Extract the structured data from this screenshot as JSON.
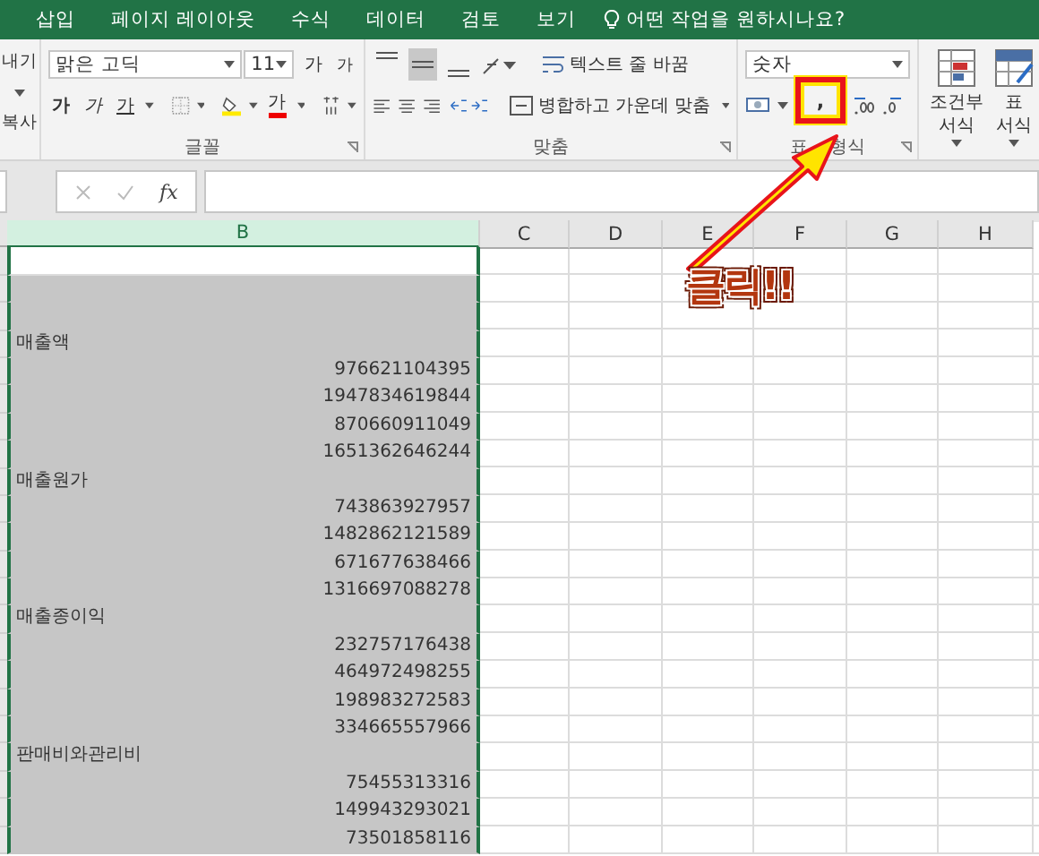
{
  "tabs": [
    {
      "label": "삽입"
    },
    {
      "label": "페이지 레이아웃"
    },
    {
      "label": "수식"
    },
    {
      "label": "데이터"
    },
    {
      "label": "검토"
    },
    {
      "label": "보기"
    }
  ],
  "tell_me": "어떤 작업을 원하시나요?",
  "ribbon": {
    "clipboard": {
      "items": [
        "내기",
        "복사"
      ]
    },
    "font": {
      "name": "맑은 고딕",
      "size": "11",
      "grow": "가",
      "shrink": "가",
      "bold": "가",
      "italic": "가",
      "underline": "가",
      "font_color": "가",
      "label": "글꼴"
    },
    "alignment": {
      "vertical": [
        {
          "selected": false
        },
        {
          "selected": true
        },
        {
          "selected": false
        }
      ],
      "wrap_text": "텍스트 줄 바꿈",
      "merge": "병합하고 가운데 맞춤",
      "label": "맞춤"
    },
    "number": {
      "format": "숫자",
      "comma": ",",
      "label_parts": [
        "표",
        "형식"
      ]
    },
    "styles": [
      {
        "label": "조건부 서식"
      },
      {
        "label": "표 서식"
      }
    ]
  },
  "formula_bar": {
    "fx": "fx"
  },
  "columns": [
    {
      "label": "B",
      "selected": true
    },
    {
      "label": "C",
      "selected": false
    },
    {
      "label": "D",
      "selected": false
    },
    {
      "label": "E",
      "selected": false
    },
    {
      "label": "F",
      "selected": false
    },
    {
      "label": "G",
      "selected": false
    },
    {
      "label": "H",
      "selected": false
    }
  ],
  "rows": [
    {
      "kind": "blank",
      "active": true
    },
    {
      "kind": "blank",
      "active": false
    },
    {
      "kind": "blank",
      "active": false
    },
    {
      "kind": "label",
      "text": "매출액",
      "active": false
    },
    {
      "kind": "number",
      "text": "976621104395",
      "active": false
    },
    {
      "kind": "number",
      "text": "1947834619844",
      "active": false
    },
    {
      "kind": "number",
      "text": "870660911049",
      "active": false
    },
    {
      "kind": "number",
      "text": "1651362646244",
      "active": false
    },
    {
      "kind": "label",
      "text": "매출원가",
      "active": false
    },
    {
      "kind": "number",
      "text": "743863927957",
      "active": false
    },
    {
      "kind": "number",
      "text": "1482862121589",
      "active": false
    },
    {
      "kind": "number",
      "text": "671677638466",
      "active": false
    },
    {
      "kind": "number",
      "text": "1316697088278",
      "active": false
    },
    {
      "kind": "label",
      "text": "매출종이익",
      "active": false
    },
    {
      "kind": "number",
      "text": "232757176438",
      "active": false
    },
    {
      "kind": "number",
      "text": "464972498255",
      "active": false
    },
    {
      "kind": "number",
      "text": "198983272583",
      "active": false
    },
    {
      "kind": "number",
      "text": "334665557966",
      "active": false
    },
    {
      "kind": "label",
      "text": "판매비와관리비",
      "active": false
    },
    {
      "kind": "number",
      "text": "75455313316",
      "active": false
    },
    {
      "kind": "number",
      "text": "149943293021",
      "active": false
    },
    {
      "kind": "number",
      "text": "73501858116",
      "active": false
    }
  ],
  "callout": {
    "text": "클릭!!"
  }
}
